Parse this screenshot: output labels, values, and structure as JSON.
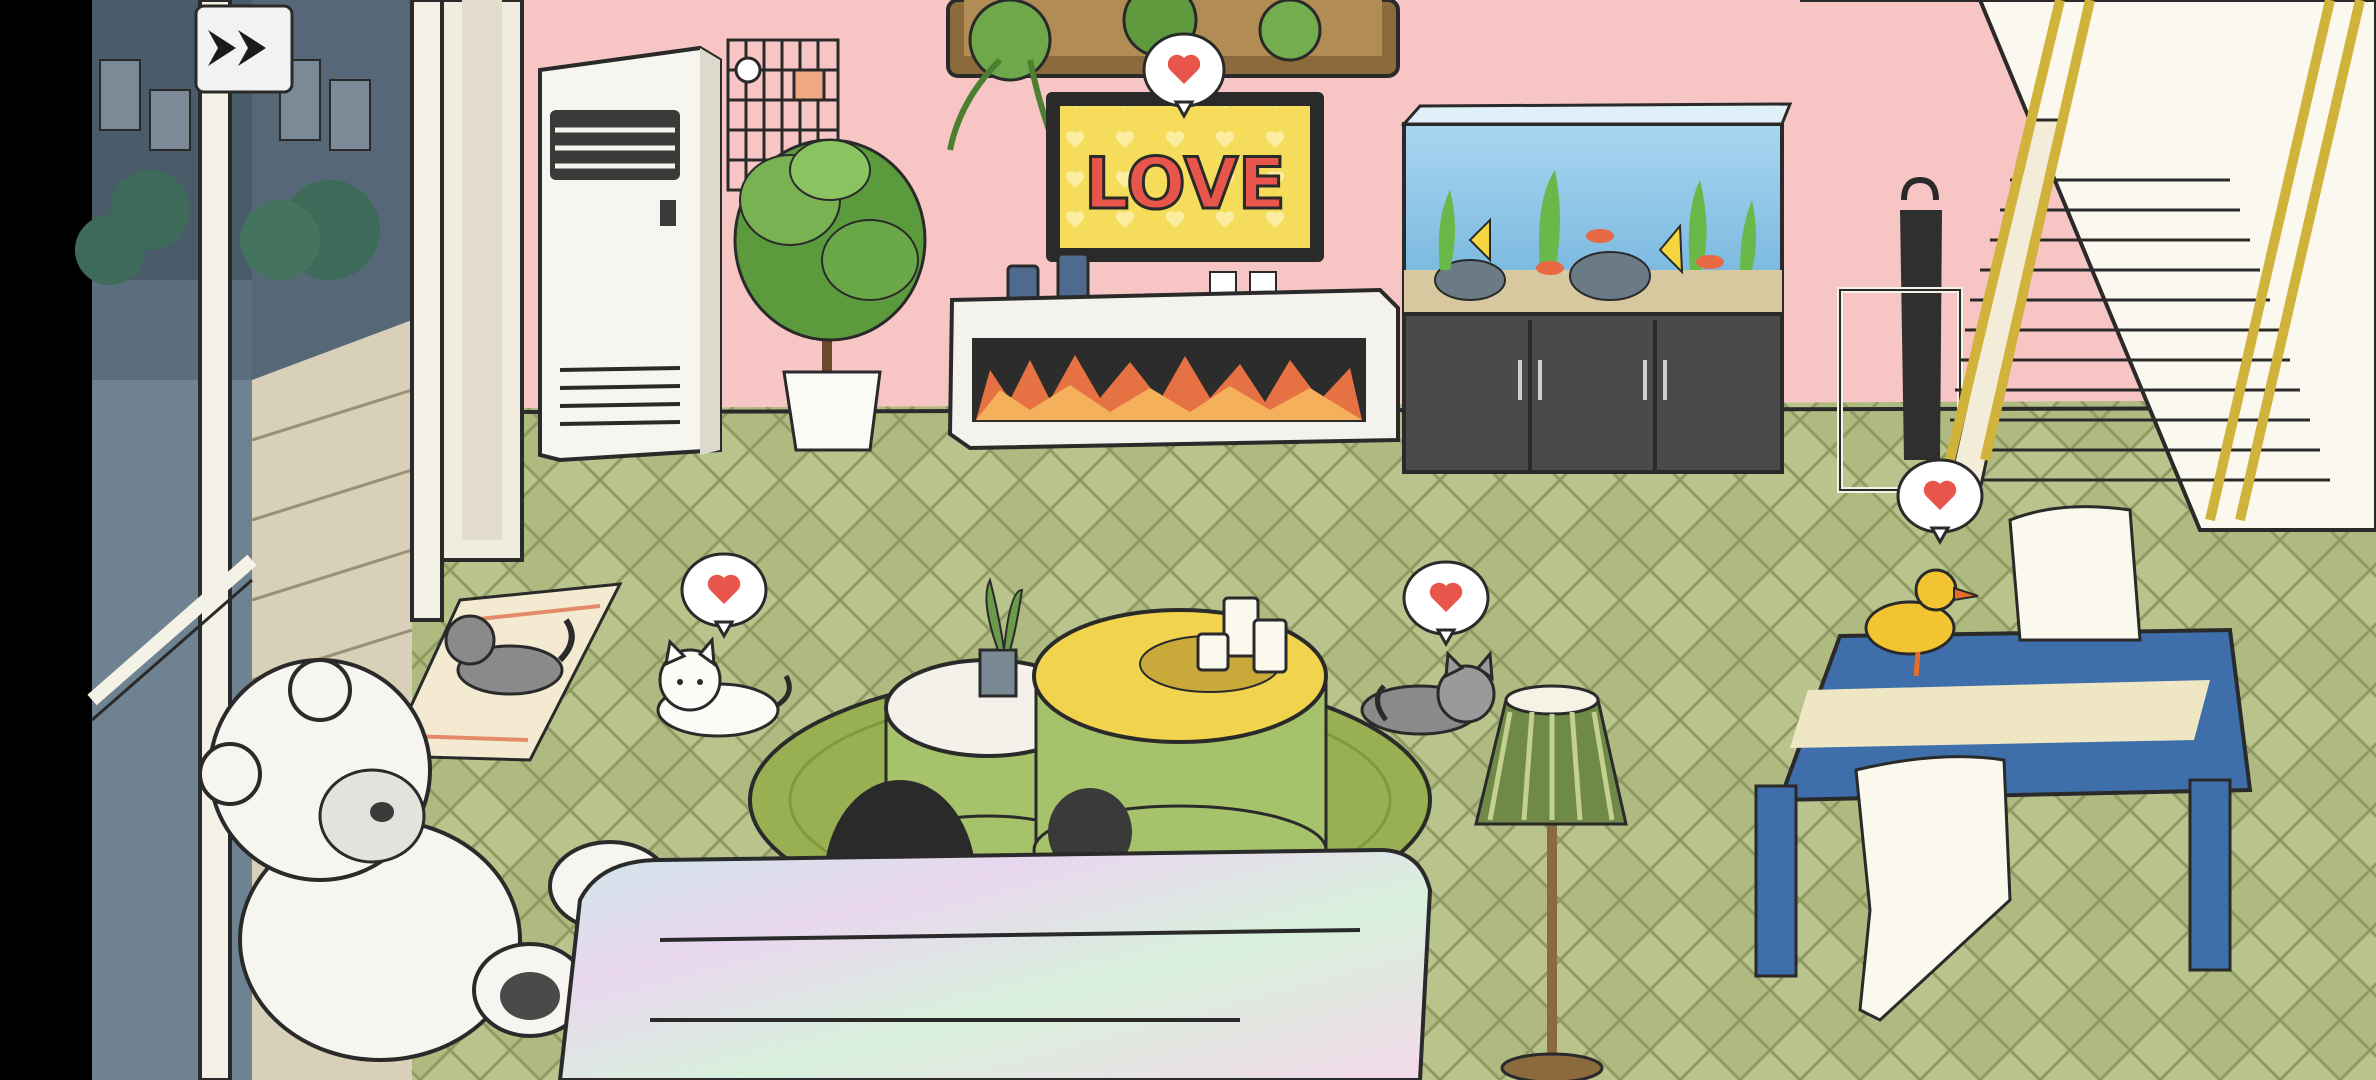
{
  "scene": {
    "tv_screen_text": "LOVE",
    "skip_button": {
      "icon": "fast-forward-icon"
    },
    "heart_bubbles": [
      {
        "name": "heart-bubble-tv",
        "icon": "heart-icon"
      },
      {
        "name": "heart-bubble-white-cat",
        "icon": "heart-icon"
      },
      {
        "name": "heart-bubble-gray-cat",
        "icon": "heart-icon"
      },
      {
        "name": "heart-bubble-duck",
        "icon": "heart-icon"
      }
    ]
  },
  "colors": {
    "wall": "#f7c6c4",
    "floor": "#b9c48c",
    "outline": "#2a2a2a",
    "heart": "#e8554b",
    "tv_screen": "#f5dc5a",
    "rug": "#98b052",
    "table_top": "#f2d34e",
    "dining_cloth": "#3e6faa",
    "duck": "#f2c432"
  }
}
